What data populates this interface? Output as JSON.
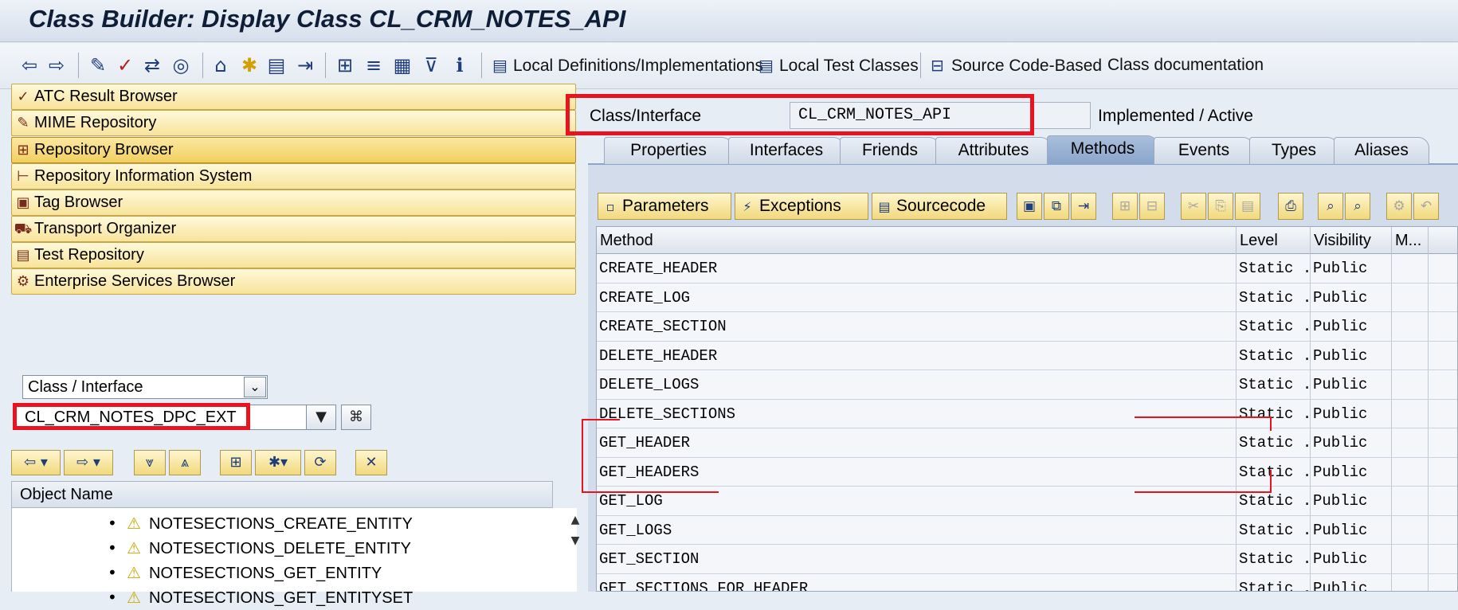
{
  "title": "Class Builder: Display Class CL_CRM_NOTES_API",
  "toolbar": {
    "icons": [
      "back-arrow-icon",
      "forward-arrow-icon",
      "display-change-icon",
      "check-icon",
      "activate-icon",
      "where-used-icon",
      "object-list-icon",
      "navigate-icon",
      "display-object-list-icon",
      "navigation-window-icon",
      "hierarchy-icon",
      "other-object-icon",
      "inactive-objects-icon",
      "filter-icon",
      "info-icon"
    ],
    "local_definitions": "Local Definitions/Implementations",
    "local_test_classes": "Local Test Classes",
    "source_code_based": "Source Code-Based",
    "class_documentation": "Class documentation"
  },
  "nav": {
    "items": [
      {
        "label": "ATC Result Browser",
        "icon": "atc-icon"
      },
      {
        "label": "MIME Repository",
        "icon": "mime-icon"
      },
      {
        "label": "Repository Browser",
        "icon": "repository-icon"
      },
      {
        "label": "Repository Information System",
        "icon": "info-system-icon"
      },
      {
        "label": "Tag Browser",
        "icon": "tag-icon"
      },
      {
        "label": "Transport Organizer",
        "icon": "truck-icon"
      },
      {
        "label": "Test Repository",
        "icon": "test-icon"
      },
      {
        "label": "Enterprise Services Browser",
        "icon": "services-icon"
      }
    ],
    "object_type": "Class / Interface",
    "object_name": "CL_CRM_NOTES_DPC_EXT"
  },
  "tree": {
    "header": "Object Name",
    "items": [
      "NOTESECTIONS_CREATE_ENTITY",
      "NOTESECTIONS_DELETE_ENTITY",
      "NOTESECTIONS_GET_ENTITY",
      "NOTESECTIONS_GET_ENTITYSET"
    ]
  },
  "header": {
    "label": "Class/Interface",
    "value": "CL_CRM_NOTES_API",
    "status": "Implemented / Active"
  },
  "tabs": [
    "Properties",
    "Interfaces",
    "Friends",
    "Attributes",
    "Methods",
    "Events",
    "Types",
    "Aliases"
  ],
  "active_tab": "Methods",
  "subtoolbar": {
    "parameters": "Parameters",
    "exceptions": "Exceptions",
    "sourcecode": "Sourcecode"
  },
  "grid": {
    "columns": [
      "Method",
      "Level",
      "Visibility",
      "M..."
    ],
    "rows": [
      [
        "CREATE_HEADER",
        "Static ...",
        "Public"
      ],
      [
        "CREATE_LOG",
        "Static ...",
        "Public"
      ],
      [
        "CREATE_SECTION",
        "Static ...",
        "Public"
      ],
      [
        "DELETE_HEADER",
        "Static ...",
        "Public"
      ],
      [
        "DELETE_LOGS",
        "Static ...",
        "Public"
      ],
      [
        "DELETE_SECTIONS",
        "Static ...",
        "Public"
      ],
      [
        "GET_HEADER",
        "Static ...",
        "Public"
      ],
      [
        "GET_HEADERS",
        "Static ...",
        "Public"
      ],
      [
        "GET_LOG",
        "Static ...",
        "Public"
      ],
      [
        "GET_LOGS",
        "Static ...",
        "Public"
      ],
      [
        "GET_SECTION",
        "Static ...",
        "Public"
      ],
      [
        "GET_SECTIONS_FOR_HEADER",
        "Static ...",
        "Public"
      ]
    ]
  },
  "colors": {
    "highlight": "#e8131f",
    "nav_button": "#f7e39a",
    "active_tab": "#8aa5cb"
  }
}
